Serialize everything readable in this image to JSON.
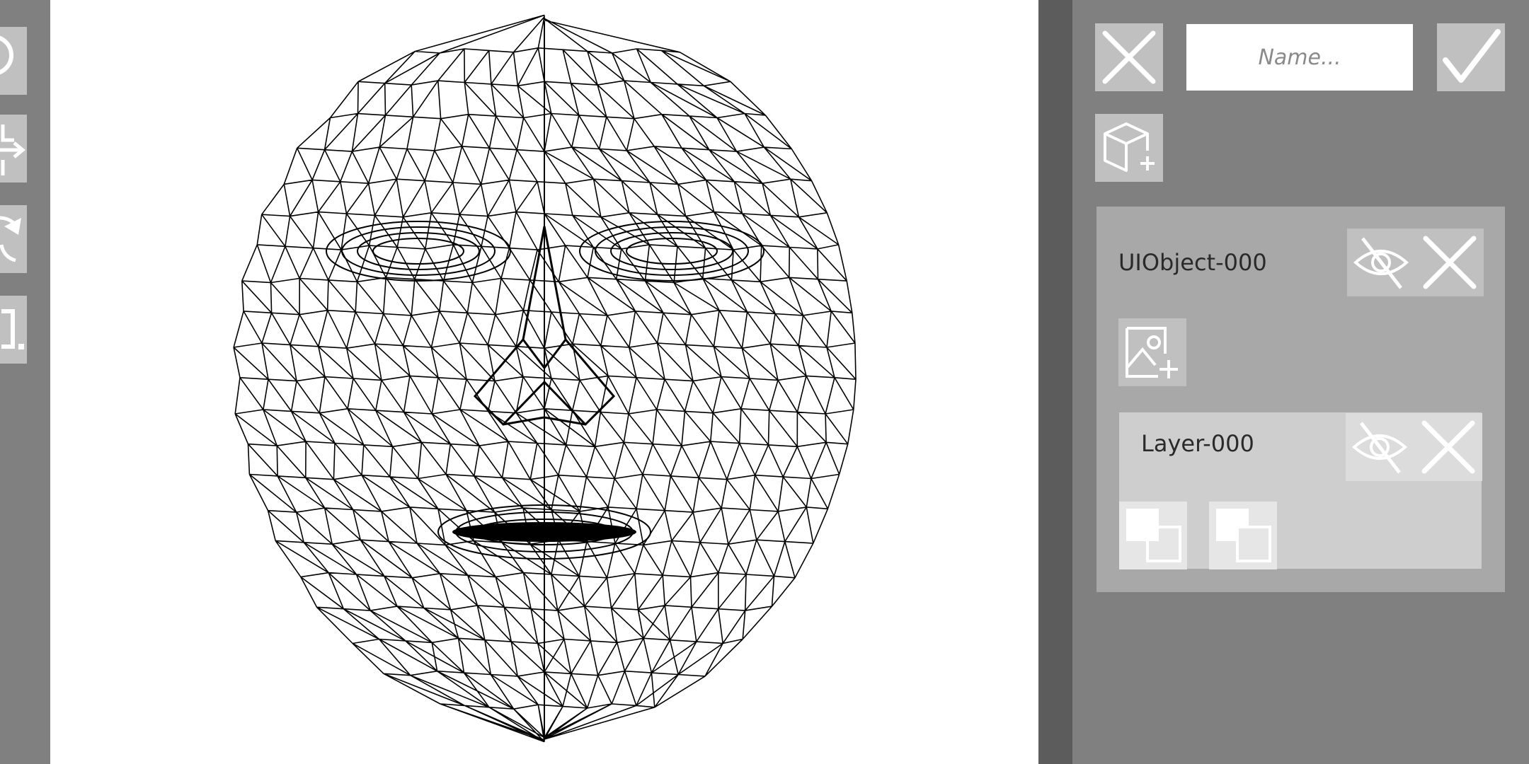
{
  "left_toolbar": {
    "tools": [
      {
        "name": "select-tool",
        "icon": "circle-icon"
      },
      {
        "name": "move-tool",
        "icon": "move-arrow-icon"
      },
      {
        "name": "rotate-tool",
        "icon": "rotate-icon"
      },
      {
        "name": "scale-tool",
        "icon": "scale-icon"
      }
    ]
  },
  "viewport": {
    "content": "face-mesh-wireframe",
    "background": "#ffffff"
  },
  "header": {
    "cancel_icon": "close-icon",
    "name_placeholder": "Name...",
    "name_value": "",
    "confirm_icon": "checkmark-icon",
    "add_object_icon": "cube-add-icon"
  },
  "objects": [
    {
      "title": "UIObject-000",
      "visibility_icon": "eye-hidden-icon",
      "delete_icon": "close-icon",
      "add_image_icon": "image-add-icon",
      "layers": [
        {
          "title": "Layer-000",
          "visibility_icon": "eye-hidden-icon",
          "delete_icon": "close-icon",
          "buttons": [
            "bring-to-front-icon",
            "send-to-back-icon"
          ]
        }
      ]
    }
  ],
  "colors": {
    "panel": "#808080",
    "divider": "#5c5c5c",
    "button": "#c0c0c0",
    "card": "#a8a8a8",
    "layer_card": "#cecece",
    "icon_stroke": "#ffffff"
  }
}
